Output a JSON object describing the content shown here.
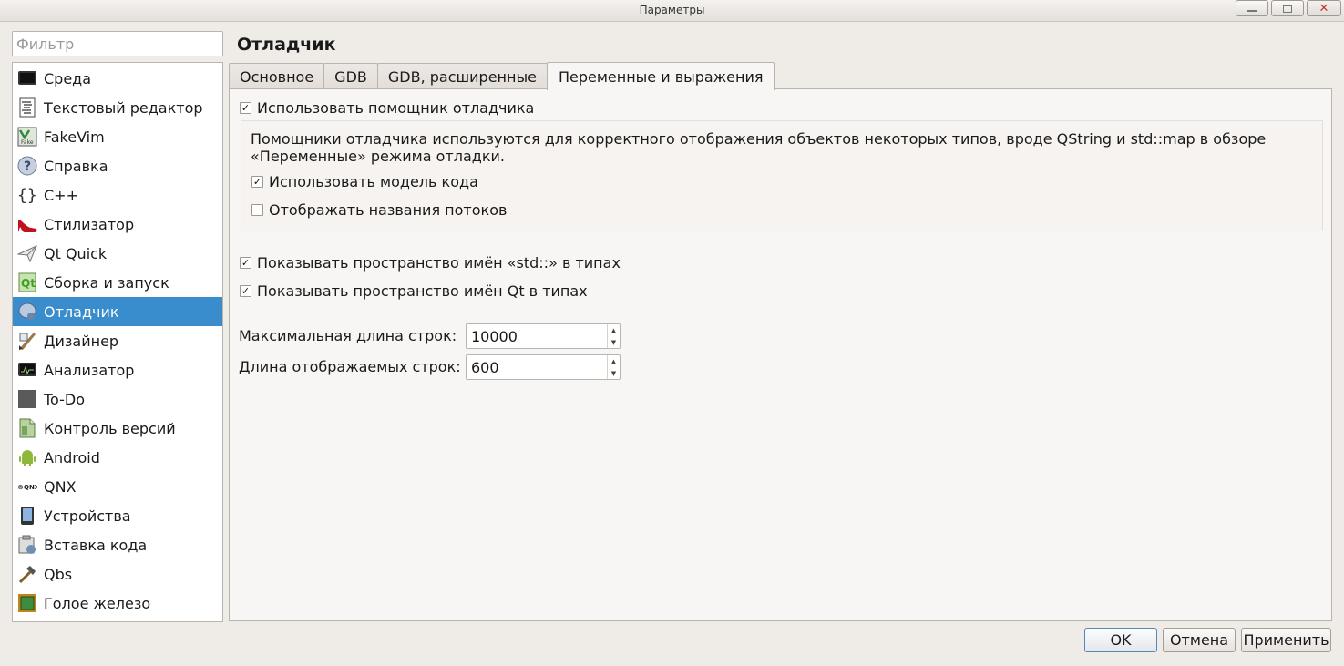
{
  "window": {
    "title": "Параметры"
  },
  "filter": {
    "placeholder": "Фильтр"
  },
  "categories": [
    {
      "label": "Среда",
      "icon": "monitor-icon"
    },
    {
      "label": "Текстовый редактор",
      "icon": "text-editor-icon"
    },
    {
      "label": "FakeVim",
      "icon": "fakevim-icon"
    },
    {
      "label": "Справка",
      "icon": "help-icon"
    },
    {
      "label": "C++",
      "icon": "braces-icon"
    },
    {
      "label": "Стилизатор",
      "icon": "high-heel-icon"
    },
    {
      "label": "Qt Quick",
      "icon": "paper-plane-icon"
    },
    {
      "label": "Сборка и запуск",
      "icon": "build-run-icon"
    },
    {
      "label": "Отладчик",
      "icon": "debugger-icon",
      "selected": true
    },
    {
      "label": "Дизайнер",
      "icon": "designer-icon"
    },
    {
      "label": "Анализатор",
      "icon": "analyzer-icon"
    },
    {
      "label": "To-Do",
      "icon": "todo-icon"
    },
    {
      "label": "Контроль версий",
      "icon": "version-control-icon"
    },
    {
      "label": "Android",
      "icon": "android-icon"
    },
    {
      "label": "QNX",
      "icon": "qnx-icon"
    },
    {
      "label": "Устройства",
      "icon": "device-icon"
    },
    {
      "label": "Вставка кода",
      "icon": "code-paste-icon"
    },
    {
      "label": "Qbs",
      "icon": "hammer-icon"
    },
    {
      "label": "Голое железо",
      "icon": "chip-icon"
    }
  ],
  "page": {
    "title": "Отладчик"
  },
  "tabs": [
    {
      "label": "Основное"
    },
    {
      "label": "GDB"
    },
    {
      "label": "GDB, расширенные"
    },
    {
      "label": "Переменные и выражения",
      "active": true
    }
  ],
  "settings": {
    "use_helper": {
      "label": "Использовать помощник отладчика",
      "checked": true
    },
    "helper_description": "Помощники отладчика используются для корректного отображения объектов некоторых типов, вроде QString и std::map в обзоре «Переменные» режима отладки.",
    "use_code_model": {
      "label": "Использовать модель кода",
      "checked": true
    },
    "show_thread_names": {
      "label": "Отображать названия потоков",
      "checked": false
    },
    "show_std_namespace": {
      "label": "Показывать пространство имён «std::» в типах",
      "checked": true
    },
    "show_qt_namespace": {
      "label": "Показывать пространство имён Qt в типах",
      "checked": true
    },
    "max_string_length": {
      "label": "Максимальная длина строк:",
      "value": "10000"
    },
    "display_string_length": {
      "label": "Длина отображаемых строк:",
      "value": "600"
    }
  },
  "buttons": {
    "ok": "OK",
    "cancel": "Отмена",
    "apply": "Применить"
  },
  "colors": {
    "selection": "#3a8dcc",
    "window_bg": "#efebe7"
  },
  "check_mark": "✓"
}
